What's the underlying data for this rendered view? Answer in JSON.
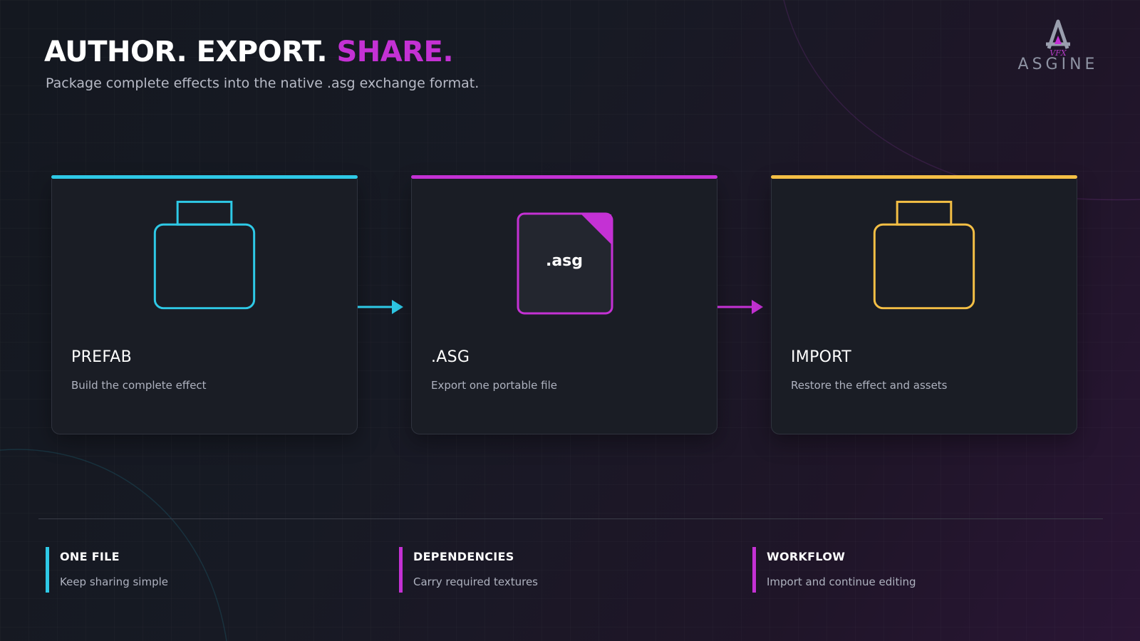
{
  "header": {
    "title_main": "AUTHOR. EXPORT.",
    "title_accent": "SHARE.",
    "subtitle": "Package complete effects into the native .asg exchange format."
  },
  "logo": {
    "name": "ASGINE",
    "sub": "VFX"
  },
  "colors": {
    "cyan": "#2ec9e6",
    "magenta": "#c431d4",
    "gold": "#f4bf45"
  },
  "steps": [
    {
      "title": "PREFAB",
      "description": "Build the complete effect",
      "icon": "container-icon",
      "accent": "#2ec9e6"
    },
    {
      "title": ".ASG",
      "description": "Export one portable file",
      "icon": "asg-file-icon",
      "file_label": ".asg",
      "accent": "#c431d4"
    },
    {
      "title": "IMPORT",
      "description": "Restore the effect and assets",
      "icon": "container-icon",
      "accent": "#f4bf45"
    }
  ],
  "features": [
    {
      "title": "ONE FILE",
      "description": "Keep sharing simple",
      "accent": "#2ec9e6"
    },
    {
      "title": "DEPENDENCIES",
      "description": "Carry required textures",
      "accent": "#c431d4"
    },
    {
      "title": "WORKFLOW",
      "description": "Import and continue editing",
      "accent": "#c431d4"
    }
  ]
}
